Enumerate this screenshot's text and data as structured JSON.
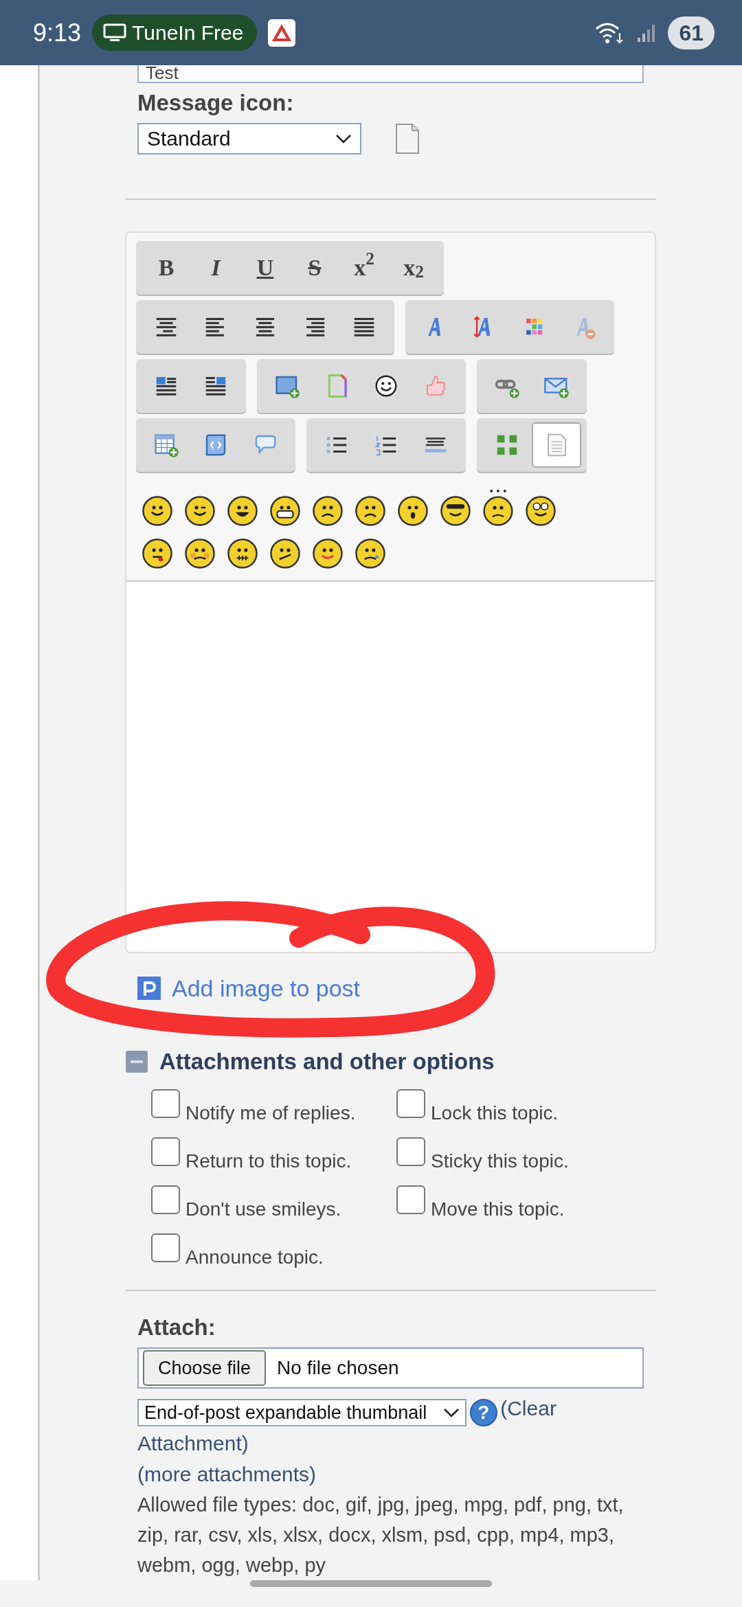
{
  "status_bar": {
    "time": "9:13",
    "media_chip": "TuneIn Free",
    "battery": "61"
  },
  "subject": {
    "value": "Test"
  },
  "message_icon": {
    "label": "Message icon:",
    "value": "Standard"
  },
  "toolbar": [
    [
      {
        "buttons": [
          {
            "kind": "bold",
            "label": "B"
          },
          {
            "kind": "italic",
            "label": "I"
          },
          {
            "kind": "underline",
            "label": "U"
          },
          {
            "kind": "strike",
            "label": "S"
          },
          {
            "kind": "superscript",
            "label": "x$^{2}$"
          },
          {
            "kind": "subscript",
            "label": "x$_{2}$"
          }
        ]
      }
    ],
    [
      {
        "buttons": [
          {
            "kind": "align-indent"
          },
          {
            "kind": "align-left"
          },
          {
            "kind": "align-center"
          },
          {
            "kind": "align-right"
          },
          {
            "kind": "align-justify"
          }
        ]
      },
      {
        "buttons": [
          {
            "kind": "font-face"
          },
          {
            "kind": "font-size"
          },
          {
            "kind": "font-color"
          },
          {
            "kind": "remove-format"
          }
        ]
      }
    ],
    [
      {
        "buttons": [
          {
            "kind": "float-left"
          },
          {
            "kind": "float-right"
          }
        ]
      },
      {
        "buttons": [
          {
            "kind": "image"
          },
          {
            "kind": "flash"
          },
          {
            "kind": "emoticon"
          },
          {
            "kind": "thumbs-up"
          }
        ]
      },
      {
        "buttons": [
          {
            "kind": "link"
          },
          {
            "kind": "email"
          }
        ]
      }
    ],
    [
      {
        "buttons": [
          {
            "kind": "table"
          },
          {
            "kind": "code"
          },
          {
            "kind": "quote"
          }
        ]
      },
      {
        "buttons": [
          {
            "kind": "bullet-list"
          },
          {
            "kind": "numbered-list"
          },
          {
            "kind": "horizontal-rule"
          }
        ]
      },
      {
        "buttons": [
          {
            "kind": "wysiwyg",
            "selected": false
          },
          {
            "kind": "source",
            "selected": true
          }
        ]
      }
    ]
  ],
  "smileys": [
    {
      "kind": "smile"
    },
    {
      "kind": "wink"
    },
    {
      "kind": "cheesy"
    },
    {
      "kind": "grin"
    },
    {
      "kind": "angry"
    },
    {
      "kind": "sad"
    },
    {
      "kind": "shocked"
    },
    {
      "kind": "cool"
    },
    {
      "kind": "huh"
    },
    {
      "kind": "rolleyes"
    },
    {
      "kind": "tongue"
    },
    {
      "kind": "embarrassed"
    },
    {
      "kind": "lipsrsealed"
    },
    {
      "kind": "undecided"
    },
    {
      "kind": "kiss"
    },
    {
      "kind": "cry"
    }
  ],
  "add_image_link": "Add image to post",
  "options": {
    "title": "Attachments and other options",
    "checkboxes": [
      {
        "label": "Notify me of replies.",
        "checked": false
      },
      {
        "label": "Lock this topic.",
        "checked": false
      },
      {
        "label": "Return to this topic.",
        "checked": false
      },
      {
        "label": "Sticky this topic.",
        "checked": false
      },
      {
        "label": "Don't use smileys.",
        "checked": false
      },
      {
        "label": "Move this topic.",
        "checked": false
      },
      {
        "label": "Announce topic.",
        "checked": false
      }
    ]
  },
  "attach": {
    "label": "Attach:",
    "choose_button": "Choose file",
    "file_status": "No file chosen",
    "mode": "End-of-post expandable thumbnail",
    "help": "?",
    "clear_link": "(Clear Attachment)",
    "more_link": "(more attachments)",
    "allowed": "Allowed file types: doc, gif, jpg, jpeg, mpg, pdf, png, txt, zip, rar, csv, xls, xlsx, docx, xlsm, psd, cpp, mp4, mp3, webm, ogg, webp, py"
  }
}
